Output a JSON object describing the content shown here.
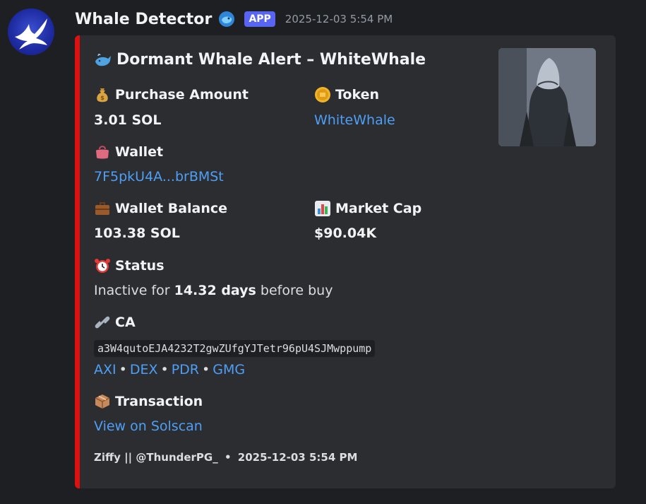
{
  "header": {
    "username": "Whale Detector",
    "badge": "APP",
    "timestamp": "2025-12-03 5:54 PM"
  },
  "embed": {
    "accent_color": "#e01010",
    "title": "Dormant Whale Alert – WhiteWhale",
    "title_icon": "whale-emoji",
    "thumbnail": "armored-whale-character-image",
    "fields": {
      "purchase_amount": {
        "icon": "money-bag-emoji",
        "name": "Purchase Amount",
        "value": "3.01 SOL"
      },
      "token": {
        "icon": "coin-emoji",
        "name": "Token",
        "value": "WhiteWhale"
      },
      "wallet": {
        "icon": "purse-emoji",
        "name": "Wallet",
        "value": "7F5pkU4A...brBMSt"
      },
      "wallet_balance": {
        "icon": "briefcase-emoji",
        "name": "Wallet Balance",
        "value": "103.38 SOL"
      },
      "market_cap": {
        "icon": "bar-chart-emoji",
        "name": "Market Cap",
        "value": "$90.04K"
      },
      "status": {
        "icon": "alarm-clock-emoji",
        "name": "Status",
        "value_prefix": "Inactive for ",
        "value_bold": "14.32 days",
        "value_suffix": " before buy"
      },
      "ca": {
        "icon": "link-emoji",
        "name": "CA",
        "value": "a3W4qutoEJA4232T2gwZUfgYJTetr96pU4SJMwppump",
        "links": [
          "AXI",
          "DEX",
          "PDR",
          "GMG"
        ],
        "separator": "•"
      },
      "transaction": {
        "icon": "package-emoji",
        "name": "Transaction",
        "value": "View on Solscan"
      }
    },
    "footer": {
      "text": "Ziffy || @ThunderPG_",
      "separator": "•",
      "timestamp": "2025-12-03 5:54 PM"
    }
  },
  "colors": {
    "background": "#1e1f22",
    "embed_bg": "#2b2d31",
    "link": "#4e9ff5",
    "badge": "#5865f2"
  }
}
